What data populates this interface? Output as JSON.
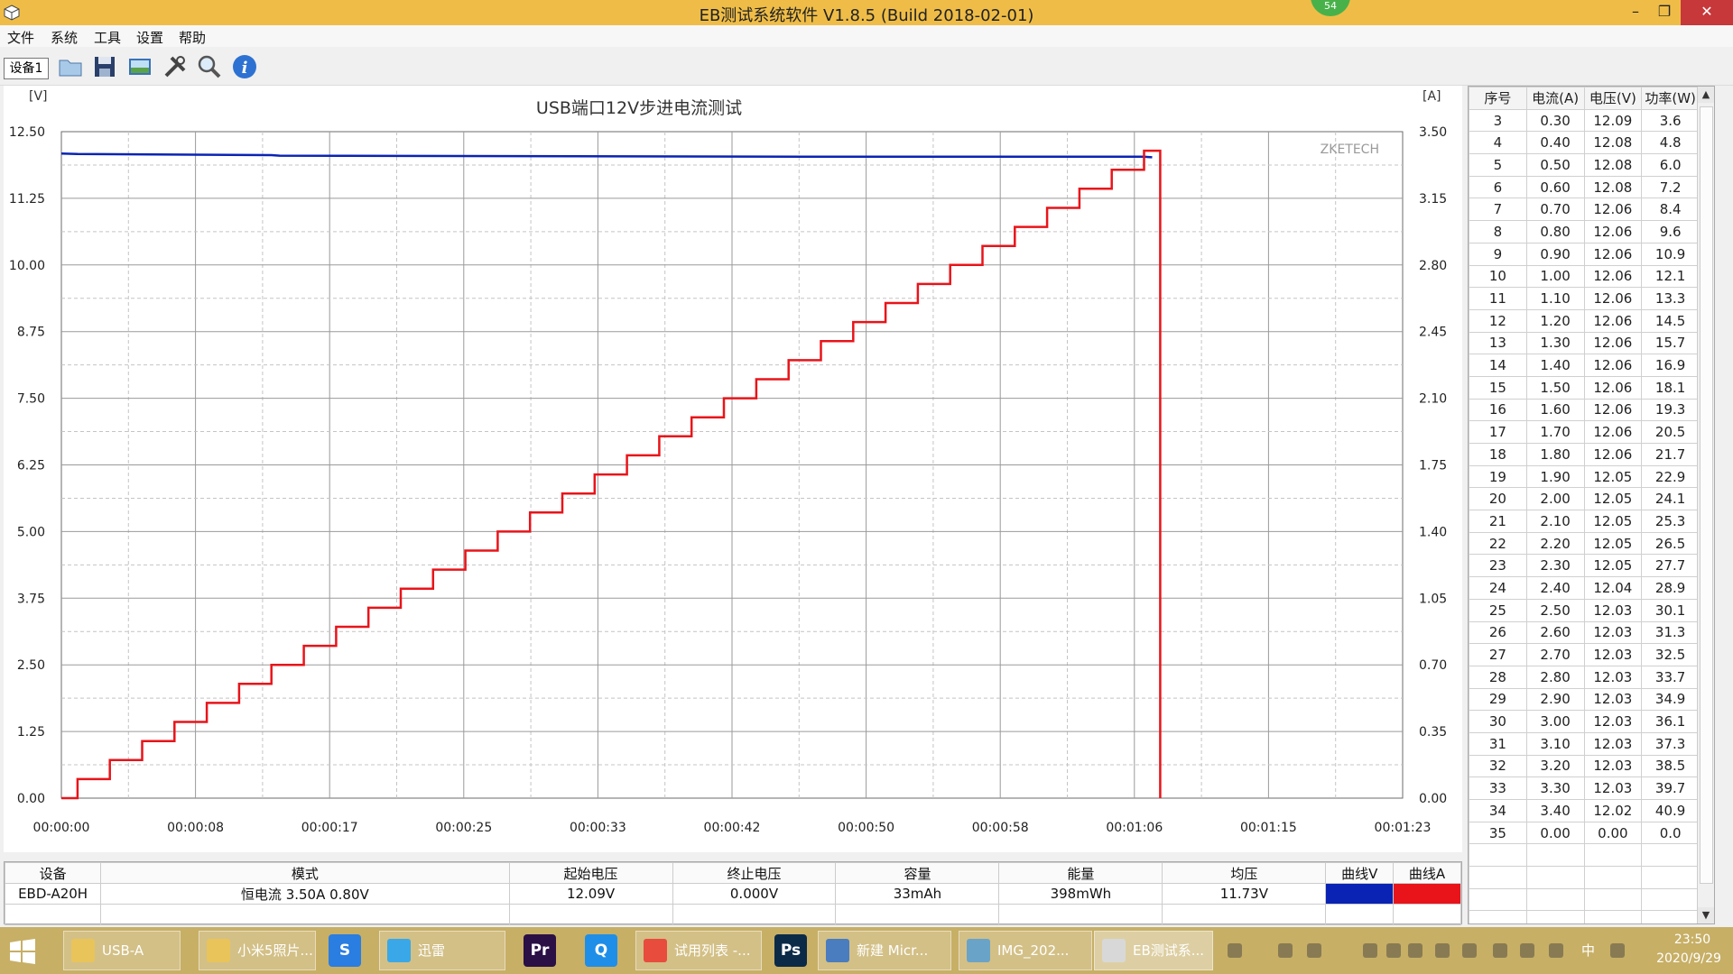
{
  "window": {
    "title": "EB测试系统软件 V1.8.5 (Build 2018-02-01)",
    "badge": "54",
    "min": "–",
    "max": "❐",
    "close": "✕"
  },
  "menu": [
    "文件",
    "系统",
    "工具",
    "设置",
    "帮助"
  ],
  "toolbar": {
    "device_tab": "设备1",
    "buttons": [
      "open-icon",
      "save-icon",
      "screenshot-icon",
      "tools-icon",
      "search-icon",
      "info-icon"
    ]
  },
  "colors": {
    "voltage": "#0a23b4",
    "current": "#e8141a",
    "titlebar": "#efbd47",
    "taskbar": "#c7af66"
  },
  "chart_data": {
    "type": "line",
    "title": "USB端口12V步进电流测试",
    "watermark": "ZKETECH",
    "left_unit": "[V]",
    "right_unit": "[A]",
    "left_ticks": [
      "12.50",
      "11.25",
      "10.00",
      "8.75",
      "7.50",
      "6.25",
      "5.00",
      "3.75",
      "2.50",
      "1.25",
      "0.00"
    ],
    "right_ticks": [
      "3.50",
      "3.15",
      "2.80",
      "2.45",
      "2.10",
      "1.75",
      "1.40",
      "1.05",
      "0.70",
      "0.35",
      "0.00"
    ],
    "x_ticks": [
      "00:00:00",
      "00:00:08",
      "00:00:17",
      "00:00:25",
      "00:00:33",
      "00:00:42",
      "00:00:50",
      "00:00:58",
      "00:01:06",
      "00:01:15",
      "00:01:23"
    ],
    "xlim_seconds": [
      0,
      83
    ],
    "ylim_left": [
      0,
      12.5
    ],
    "ylim_right": [
      0,
      3.5
    ],
    "grid": true,
    "series": [
      {
        "axis": "left",
        "x_seconds": [
          0,
          1,
          13,
          13.5,
          47,
          47.5,
          67,
          67.5
        ],
        "values": [
          12.09,
          12.08,
          12.06,
          12.05,
          12.03,
          12.03,
          12.03,
          12.02
        ]
      },
      {
        "axis": "right",
        "step": true,
        "x_seconds": [
          0,
          1,
          3,
          5,
          7,
          9,
          11,
          13,
          15,
          17,
          19,
          21,
          23,
          25,
          27,
          29,
          31,
          33,
          35,
          37,
          39,
          41,
          43,
          45,
          47,
          49,
          51,
          53,
          55,
          57,
          59,
          61,
          63,
          65,
          67,
          68,
          68
        ],
        "values": [
          0.0,
          0.1,
          0.2,
          0.3,
          0.4,
          0.5,
          0.6,
          0.7,
          0.8,
          0.9,
          1.0,
          1.1,
          1.2,
          1.3,
          1.4,
          1.5,
          1.6,
          1.7,
          1.8,
          1.9,
          2.0,
          2.1,
          2.2,
          2.3,
          2.4,
          2.5,
          2.6,
          2.7,
          2.8,
          2.9,
          3.0,
          3.1,
          3.2,
          3.3,
          3.4,
          3.4,
          0.0
        ]
      }
    ]
  },
  "data_table": {
    "headers": [
      "序号",
      "电流(A)",
      "电压(V)",
      "功率(W)"
    ],
    "rows": [
      [
        "3",
        "0.30",
        "12.09",
        "3.6"
      ],
      [
        "4",
        "0.40",
        "12.08",
        "4.8"
      ],
      [
        "5",
        "0.50",
        "12.08",
        "6.0"
      ],
      [
        "6",
        "0.60",
        "12.08",
        "7.2"
      ],
      [
        "7",
        "0.70",
        "12.06",
        "8.4"
      ],
      [
        "8",
        "0.80",
        "12.06",
        "9.6"
      ],
      [
        "9",
        "0.90",
        "12.06",
        "10.9"
      ],
      [
        "10",
        "1.00",
        "12.06",
        "12.1"
      ],
      [
        "11",
        "1.10",
        "12.06",
        "13.3"
      ],
      [
        "12",
        "1.20",
        "12.06",
        "14.5"
      ],
      [
        "13",
        "1.30",
        "12.06",
        "15.7"
      ],
      [
        "14",
        "1.40",
        "12.06",
        "16.9"
      ],
      [
        "15",
        "1.50",
        "12.06",
        "18.1"
      ],
      [
        "16",
        "1.60",
        "12.06",
        "19.3"
      ],
      [
        "17",
        "1.70",
        "12.06",
        "20.5"
      ],
      [
        "18",
        "1.80",
        "12.06",
        "21.7"
      ],
      [
        "19",
        "1.90",
        "12.05",
        "22.9"
      ],
      [
        "20",
        "2.00",
        "12.05",
        "24.1"
      ],
      [
        "21",
        "2.10",
        "12.05",
        "25.3"
      ],
      [
        "22",
        "2.20",
        "12.05",
        "26.5"
      ],
      [
        "23",
        "2.30",
        "12.05",
        "27.7"
      ],
      [
        "24",
        "2.40",
        "12.04",
        "28.9"
      ],
      [
        "25",
        "2.50",
        "12.03",
        "30.1"
      ],
      [
        "26",
        "2.60",
        "12.03",
        "31.3"
      ],
      [
        "27",
        "2.70",
        "12.03",
        "32.5"
      ],
      [
        "28",
        "2.80",
        "12.03",
        "33.7"
      ],
      [
        "29",
        "2.90",
        "12.03",
        "34.9"
      ],
      [
        "30",
        "3.00",
        "12.03",
        "36.1"
      ],
      [
        "31",
        "3.10",
        "12.03",
        "37.3"
      ],
      [
        "32",
        "3.20",
        "12.03",
        "38.5"
      ],
      [
        "33",
        "3.30",
        "12.03",
        "39.7"
      ],
      [
        "34",
        "3.40",
        "12.02",
        "40.9"
      ],
      [
        "35",
        "0.00",
        "0.00",
        "0.0"
      ]
    ],
    "empty_rows": 5
  },
  "info_table": {
    "headers": [
      "设备",
      "模式",
      "起始电压",
      "终止电压",
      "容量",
      "能量",
      "均压",
      "曲线V",
      "曲线A"
    ],
    "row": [
      "EBD-A20H",
      "恒电流  3.50A  0.80V",
      "12.09V",
      "0.000V",
      "33mAh",
      "398mWh",
      "11.73V"
    ]
  },
  "taskbar": {
    "items": [
      {
        "label": "USB-A",
        "icon": "folder-icon",
        "color": "#e9c45a"
      },
      {
        "label": "小米5照片...",
        "icon": "folder-icon",
        "color": "#e9c45a"
      },
      {
        "label": "迅雷",
        "icon": "thunder-icon",
        "color": "#3aa8e8"
      },
      {
        "label": "试用列表 -...",
        "icon": "browser-icon",
        "color": "#e84c3d"
      },
      {
        "label": "新建 Micr...",
        "icon": "document-icon",
        "color": "#4a7cc0"
      },
      {
        "label": "IMG_202...",
        "icon": "image-icon",
        "color": "#6aa3c8"
      },
      {
        "label": "EB测试系...",
        "icon": "eb-app-icon",
        "color": "#d8d8d8"
      }
    ],
    "apps": [
      {
        "label": "S",
        "icon": "sogou-icon",
        "color": "#2a7de1"
      },
      {
        "label": "Pr",
        "icon": "premiere-icon",
        "color": "#2b1046"
      },
      {
        "label": "Q",
        "icon": "search-app-icon",
        "color": "#1f8ee8"
      },
      {
        "label": "Ps",
        "icon": "photoshop-icon",
        "color": "#0b2a48"
      }
    ],
    "tray_icons": [
      "keyboard-icon",
      "signal-icon",
      "tray-app-icon",
      "network-icon",
      "bars-icon",
      "cloud-icon",
      "qq-icon",
      "globe-icon",
      "thunder-tray-icon",
      "ghost-icon",
      "volume-icon",
      "ime-icon",
      "sogou-ime-icon"
    ],
    "ime": "中",
    "time": "23:50",
    "date": "2020/9/29"
  }
}
